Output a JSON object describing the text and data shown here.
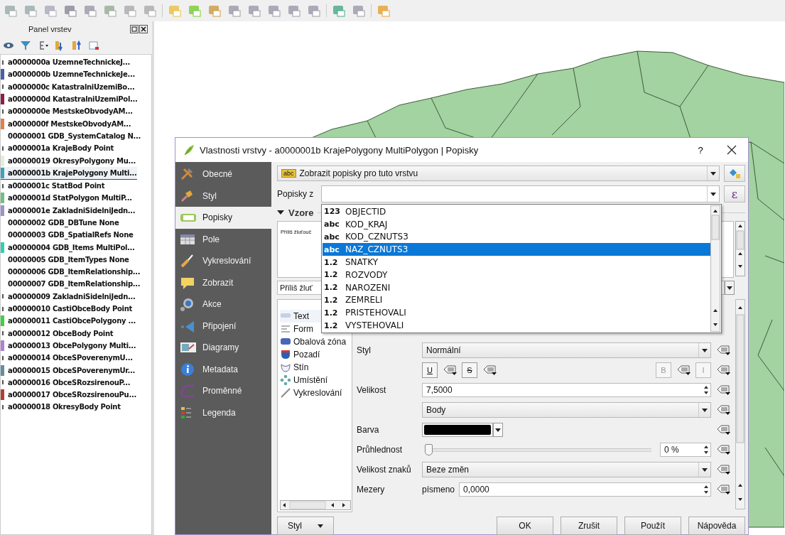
{
  "layers_panel": {
    "title": "Panel vrstev",
    "layers": [
      {
        "name": "a0000000a UzemneTechnickeJ...",
        "kind": "point",
        "selected": false
      },
      {
        "name": "a0000000b UzemneTechnickeJe...",
        "kind": "polygon",
        "color": "#4a5fa8",
        "selected": false
      },
      {
        "name": "a0000000c KatastralniUzemiBo...",
        "kind": "point",
        "selected": false
      },
      {
        "name": "a0000000d KatastralniUzemiPol...",
        "kind": "polygon",
        "color": "#8b1f4a",
        "selected": false
      },
      {
        "name": "a0000000e MestskeObvodyAM...",
        "kind": "point",
        "selected": false
      },
      {
        "name": "a0000000f MestskeObvodyAM...",
        "kind": "polygon",
        "color": "#e08050",
        "selected": false
      },
      {
        "name": "00000001 GDB_SystemCatalog N...",
        "kind": "table",
        "selected": false
      },
      {
        "name": "a0000001a KrajeBody Point",
        "kind": "point",
        "selected": false
      },
      {
        "name": "a00000019 OkresyPolygony Mu...",
        "kind": "polygon",
        "color": "#e4eedc",
        "selected": false
      },
      {
        "name": "a0000001b KrajePolygony Multi...",
        "kind": "polygon",
        "color": "#40a0c0",
        "selected": true
      },
      {
        "name": "a0000001c StatBod Point",
        "kind": "point",
        "selected": false
      },
      {
        "name": "a0000001d StatPolygon MultiP...",
        "kind": "polygon",
        "color": "#70c080",
        "selected": false
      },
      {
        "name": "a0000001e ZakladniSidelniJedn...",
        "kind": "polygon",
        "color": "#a090d0",
        "selected": false
      },
      {
        "name": "00000002 GDB_DBTune None",
        "kind": "table",
        "selected": false
      },
      {
        "name": "00000003 GDB_SpatialRefs None",
        "kind": "table",
        "selected": false
      },
      {
        "name": "a00000004 GDB_Items MultiPol...",
        "kind": "polygon",
        "color": "#30d0b0",
        "selected": false
      },
      {
        "name": "00000005 GDB_ItemTypes None",
        "kind": "table",
        "selected": false
      },
      {
        "name": "00000006 GDB_ItemRelationship...",
        "kind": "table",
        "selected": false
      },
      {
        "name": "00000007 GDB_ItemRelationship...",
        "kind": "table",
        "selected": false
      },
      {
        "name": "a00000009 ZakladniSidelniJedn...",
        "kind": "point",
        "selected": false
      },
      {
        "name": "a00000010 CastiObceBody Point",
        "kind": "point",
        "selected": false
      },
      {
        "name": "a00000011 CastiObcePolygony ...",
        "kind": "polygon",
        "color": "#40d040",
        "selected": false
      },
      {
        "name": "a00000012 ObceBody Point",
        "kind": "point",
        "selected": false
      },
      {
        "name": "a00000013 ObcePolygony Multi...",
        "kind": "polygon",
        "color": "#b080d0",
        "selected": false
      },
      {
        "name": "a00000014 ObceSPoverenymU...",
        "kind": "point",
        "selected": false
      },
      {
        "name": "a00000015 ObceSPoverenymUr...",
        "kind": "polygon",
        "color": "#6090a0",
        "selected": false
      },
      {
        "name": "a00000016 ObceSRozsirenouP...",
        "kind": "point",
        "selected": false
      },
      {
        "name": "a00000017 ObceSRozsirenouPu...",
        "kind": "polygon",
        "color": "#b04030",
        "selected": false
      },
      {
        "name": "a00000018 OkresyBody Point",
        "kind": "point",
        "selected": false
      }
    ]
  },
  "dialog": {
    "title": "Vlastnosti vrstvy - a0000001b KrajePolygony MultiPolygon | Popisky",
    "help": "?",
    "nav": [
      {
        "label": "Obecné",
        "selected": false
      },
      {
        "label": "Styl",
        "selected": false
      },
      {
        "label": "Popisky",
        "selected": true
      },
      {
        "label": "Pole",
        "selected": false
      },
      {
        "label": "Vykreslování",
        "selected": false
      },
      {
        "label": "Zobrazit",
        "selected": false
      },
      {
        "label": "Akce",
        "selected": false
      },
      {
        "label": "Připojení",
        "selected": false
      },
      {
        "label": "Diagramy",
        "selected": false
      },
      {
        "label": "Metadata",
        "selected": false
      },
      {
        "label": "Proměnné",
        "selected": false
      },
      {
        "label": "Legenda",
        "selected": false
      }
    ],
    "mode": {
      "tag": "abc",
      "value": "Zobrazit popisky pro tuto vrstvu"
    },
    "label_from": {
      "label": "Popisky z",
      "expression_button": "ε"
    },
    "field_list": [
      {
        "type": "123",
        "name": "OBJECTID",
        "selected": false
      },
      {
        "type": "abc",
        "name": "KOD_KRAJ",
        "selected": false
      },
      {
        "type": "abc",
        "name": "KOD_CZNUTS3",
        "selected": false
      },
      {
        "type": "abc",
        "name": "NAZ_CZNUTS3",
        "selected": true
      },
      {
        "type": "1.2",
        "name": "SNATKY",
        "selected": false
      },
      {
        "type": "1.2",
        "name": "ROZVODY",
        "selected": false
      },
      {
        "type": "1.2",
        "name": "NAROZENI",
        "selected": false
      },
      {
        "type": "1.2",
        "name": "ZEMRELI",
        "selected": false
      },
      {
        "type": "1.2",
        "name": "PRISTEHOVALI",
        "selected": false
      },
      {
        "type": "1.2",
        "name": "VYSTEHOVALI",
        "selected": false
      }
    ],
    "sample": {
      "heading": "Vzore",
      "expanded": true,
      "preview_text": "Příliš žluťouč",
      "sample_field": "Příliš žluť"
    },
    "sections": [
      {
        "label": "Text",
        "selected": true
      },
      {
        "label": "Form",
        "selected": false
      },
      {
        "label": "Obalová zóna",
        "selected": false
      },
      {
        "label": "Pozadí",
        "selected": false
      },
      {
        "label": "Stín",
        "selected": false
      },
      {
        "label": "Umístění",
        "selected": false
      },
      {
        "label": "Vykreslování",
        "selected": false
      }
    ],
    "form": [
      {
        "kind": "combo",
        "label": "Styl",
        "value": "Normální"
      },
      {
        "kind": "format",
        "buttons": [
          {
            "label": "U",
            "disabled": false
          },
          {
            "label": "S",
            "disabled": false
          },
          {
            "label": "B",
            "disabled": true
          },
          {
            "label": "I",
            "disabled": true
          }
        ]
      },
      {
        "kind": "spin",
        "label": "Velikost",
        "value": "7,5000"
      },
      {
        "kind": "combo",
        "value": "Body"
      },
      {
        "kind": "color",
        "label": "Barva",
        "color": "#000000"
      },
      {
        "kind": "slider",
        "label": "Průhlednost",
        "level": 0,
        "reading": "0 %"
      },
      {
        "kind": "combo",
        "label": "Velikost znaků",
        "value": "Beze změn"
      },
      {
        "kind": "spin",
        "label": "Mezery",
        "sublabel": "písmeno",
        "value": "0,0000"
      }
    ],
    "style_button": "Styl",
    "buttons": [
      "OK",
      "Zrušit",
      "Použít",
      "Nápověda"
    ]
  }
}
